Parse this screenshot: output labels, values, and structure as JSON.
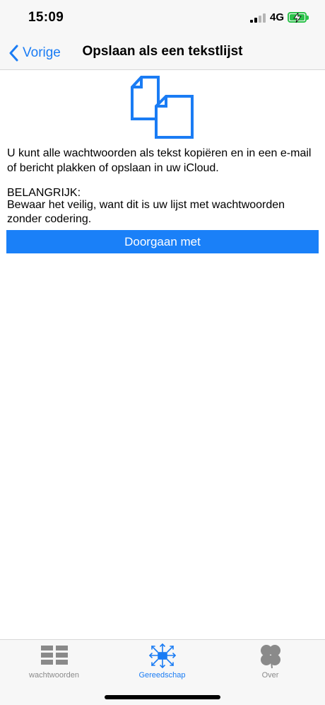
{
  "status": {
    "time": "15:09",
    "network": "4G"
  },
  "nav": {
    "back_label": "Vorige",
    "title": "Opslaan als een tekstlijst"
  },
  "content": {
    "description": "U kunt alle wachtwoorden als tekst kopiëren en in een e-mail of bericht plakken of opslaan in uw iCloud.",
    "important_heading": "BELANGRIJK:",
    "important_text": "Bewaar het veilig, want dit is uw lijst met wachtwoorden zonder codering.",
    "continue_label": "Doorgaan met"
  },
  "tabs": [
    {
      "label": "wachtwoorden",
      "icon": "list-grid-icon",
      "active": false
    },
    {
      "label": "Gereedschap",
      "icon": "tools-network-icon",
      "active": true
    },
    {
      "label": "Over",
      "icon": "clover-icon",
      "active": false
    }
  ],
  "colors": {
    "accent": "#1a7cf4",
    "button": "#1a80f8",
    "battery": "#2bc24a",
    "inactive_tab": "#8a8a8a"
  }
}
